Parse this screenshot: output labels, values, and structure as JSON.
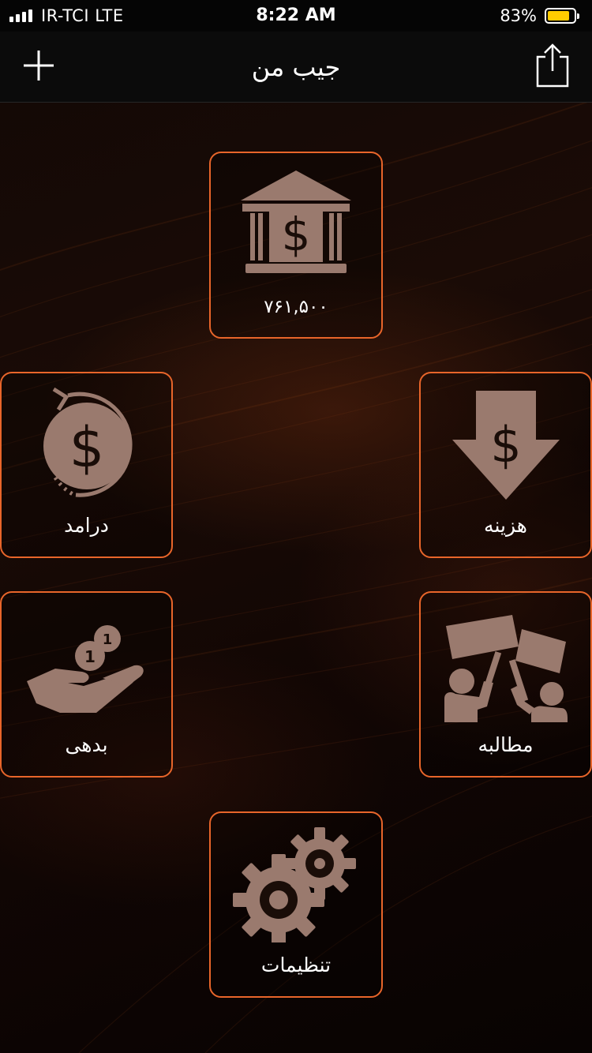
{
  "status_bar": {
    "carrier": "IR-TCI  LTE",
    "time": "8:22 AM",
    "battery_percent": "83%",
    "battery_level": 0.83,
    "battery_color": "#ffcc00"
  },
  "nav": {
    "title": "جیب من",
    "add_icon": "plus-icon",
    "share_icon": "share-icon"
  },
  "theme": {
    "accent": "#e8652a",
    "icon_color": "#9a7a6e"
  },
  "tiles": {
    "balance": {
      "value": "۷۶۱,۵۰۰",
      "icon": "bank-icon"
    },
    "income": {
      "label": "درامد",
      "icon": "coin-refund-icon"
    },
    "expense": {
      "label": "هزینه",
      "icon": "money-down-arrow-icon"
    },
    "debt": {
      "label": "بدهی",
      "icon": "hand-coins-icon"
    },
    "claim": {
      "label": "مطالبه",
      "icon": "protest-signs-icon"
    },
    "settings": {
      "label": "تنظیمات",
      "icon": "gears-icon"
    }
  }
}
